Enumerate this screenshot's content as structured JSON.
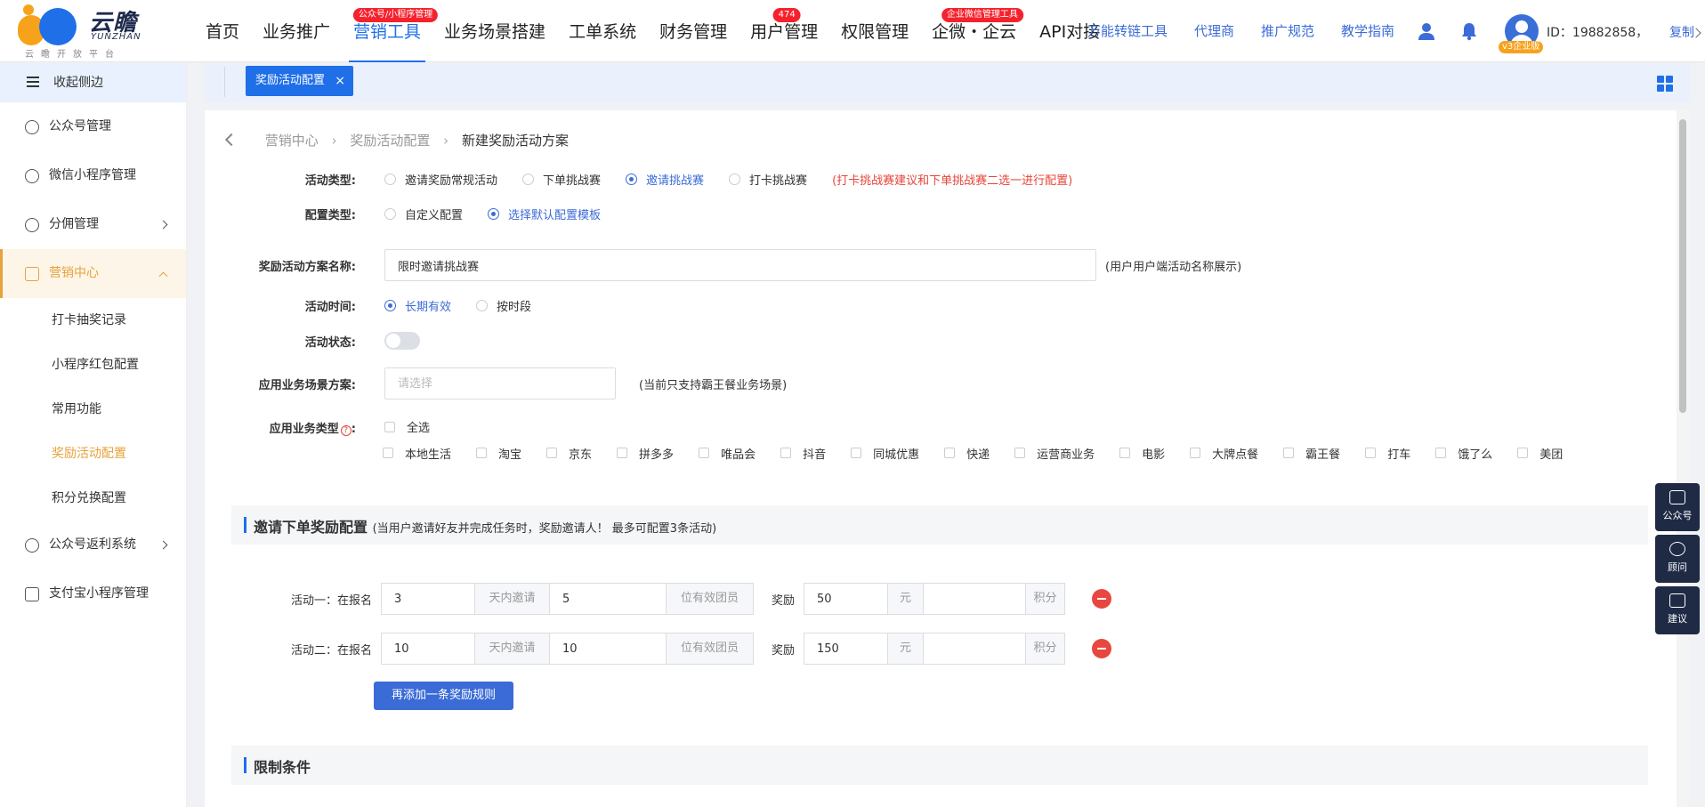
{
  "brand": {
    "name_cn": "云瞻",
    "name_en": "YUNZHAN",
    "slogan": "云瞻开放平台"
  },
  "topnav": {
    "menu": [
      {
        "label": "首页",
        "badge": ""
      },
      {
        "label": "业务推广",
        "badge": ""
      },
      {
        "label": "营销工具",
        "badge": "公众号/小程序管理",
        "active": true
      },
      {
        "label": "业务场景搭建",
        "badge": ""
      },
      {
        "label": "工单系统",
        "badge": ""
      },
      {
        "label": "财务管理",
        "badge": ""
      },
      {
        "label": "用户管理",
        "badge": "474"
      },
      {
        "label": "权限管理",
        "badge": ""
      },
      {
        "label": "企微・企云",
        "badge": "企业微信管理工具"
      },
      {
        "label": "API对接",
        "badge": ""
      }
    ],
    "quick_links": [
      "万能转链工具",
      "代理商",
      "推广规范",
      "教学指南"
    ],
    "user": {
      "id_text": "ID：19882858，",
      "copy_label": "复制",
      "version_badge": "v3企业版"
    }
  },
  "sidebar": {
    "collapse_label": "收起侧边",
    "items": [
      {
        "label": "公众号管理"
      },
      {
        "label": "微信小程序管理"
      },
      {
        "label": "分佣管理"
      },
      {
        "label": "营销中心"
      },
      {
        "label": "公众号返利系统"
      },
      {
        "label": "支付宝小程序管理"
      }
    ],
    "sub_items": [
      {
        "label": "打卡抽奖记录"
      },
      {
        "label": "小程序红包配置"
      },
      {
        "label": "常用功能"
      },
      {
        "label": "奖励活动配置"
      },
      {
        "label": "积分兑换配置"
      }
    ]
  },
  "tabbar": {
    "tab_label": "奖励活动配置",
    "close": "×"
  },
  "breadcrumb": {
    "items": [
      "营销中心",
      "奖励活动配置",
      "新建奖励活动方案"
    ],
    "sep": "›"
  },
  "form": {
    "activity_type": {
      "label": "活动类型:",
      "options": [
        "邀请奖励常规活动",
        "下单挑战赛",
        "邀请挑战赛",
        "打卡挑战赛"
      ],
      "selected": "邀请挑战赛",
      "warning": "(打卡挑战赛建议和下单挑战赛二选一进行配置)"
    },
    "config_type": {
      "label": "配置类型:",
      "options": [
        "自定义配置",
        "选择默认配置模板"
      ],
      "selected": "选择默认配置模板"
    },
    "scheme_name": {
      "label": "奖励活动方案名称:",
      "value": "限时邀请挑战赛",
      "hint": "(用户用户端活动名称展示)"
    },
    "activity_time": {
      "label": "活动时间:",
      "options": [
        "长期有效",
        "按时段"
      ],
      "selected": "长期有效"
    },
    "activity_status": {
      "label": "活动状态:",
      "on": false
    },
    "scene_scheme": {
      "label": "应用业务场景方案:",
      "placeholder": "请选择",
      "hint": "(当前只支持霸王餐业务场景)"
    },
    "business_type": {
      "label": "应用业务类型",
      "help": "?",
      "select_all": "全选",
      "options": [
        "本地生活",
        "淘宝",
        "京东",
        "拼多多",
        "唯品会",
        "抖音",
        "同城优惠",
        "快递",
        "运营商业务",
        "电影",
        "大牌点餐",
        "霸王餐",
        "打车",
        "饿了么",
        "美团"
      ]
    }
  },
  "reward_section": {
    "title": "邀请下单奖励配置",
    "subtitle": "(当用户邀请好友并完成任务时，奖励邀请人！ 最多可配置3条活动)",
    "rows": [
      {
        "label": "活动一：在报名",
        "days": "3",
        "days_unit": "天内邀请",
        "members": "5",
        "members_unit": "位有效团员",
        "reward_label": "奖励",
        "yuan": "50",
        "yuan_unit": "元",
        "points": "",
        "points_unit": "积分"
      },
      {
        "label": "活动二：在报名",
        "days": "10",
        "days_unit": "天内邀请",
        "members": "10",
        "members_unit": "位有效团员",
        "reward_label": "奖励",
        "yuan": "150",
        "yuan_unit": "元",
        "points": "",
        "points_unit": "积分"
      }
    ],
    "add_button": "再添加一条奖励规则"
  },
  "limit_section": {
    "title": "限制条件"
  },
  "float_panel": [
    "公众号",
    "顾问",
    "建议"
  ],
  "colors": {
    "primary": "#1f6fe8",
    "accent": "#e6a23c",
    "danger": "#e8473f"
  }
}
